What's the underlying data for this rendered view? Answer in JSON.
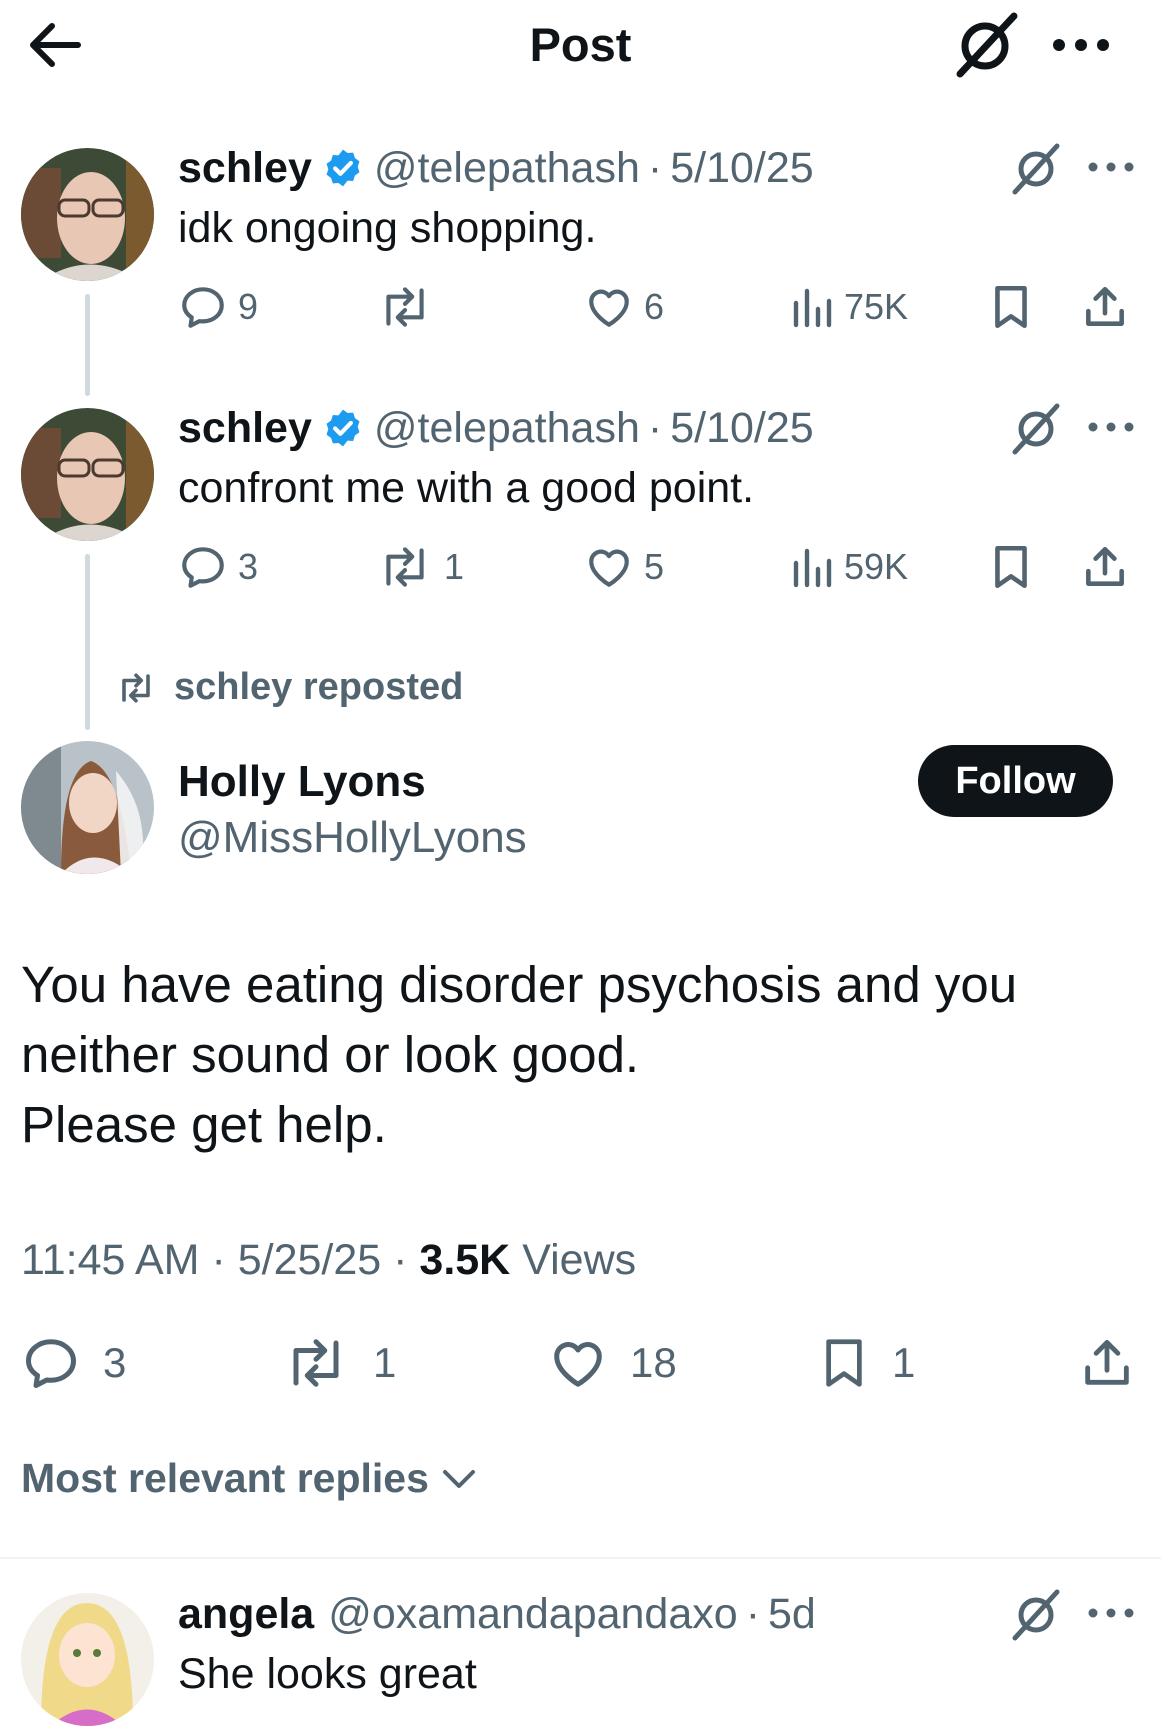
{
  "header": {
    "title": "Post",
    "back_icon": "arrow-left-icon",
    "grok_icon": "grok-icon",
    "more_icon": "more-horizontal-icon"
  },
  "thread": [
    {
      "name": "schley",
      "handle": "@telepathash",
      "date": "5/10/25",
      "text": "idk ongoing shopping.",
      "replies": "9",
      "reposts": "",
      "likes": "6",
      "views": "75K"
    },
    {
      "name": "schley",
      "handle": "@telepathash",
      "date": "5/10/25",
      "text": "confront me with a good point.",
      "replies": "3",
      "reposts": "1",
      "likes": "5",
      "views": "59K"
    }
  ],
  "repost_banner": "schley reposted",
  "main_post": {
    "name": "Holly Lyons",
    "handle": "@MissHollyLyons",
    "follow_label": "Follow",
    "text": "You have eating disorder psychosis and you\nneither sound or look good.\nPlease get help.",
    "time": "11:45 AM",
    "date": "5/25/25",
    "views_count": "3.5K",
    "views_label": "Views",
    "replies": "3",
    "reposts": "1",
    "likes": "18",
    "bookmarks": "1"
  },
  "replies_sort": "Most relevant replies",
  "reply": {
    "name": "angela",
    "handle": "@oxamandapandaxo",
    "date": "5d",
    "text": "She looks great"
  },
  "colors": {
    "text": "#0f1419",
    "secondary": "#536471",
    "verified": "#1d9bf0",
    "divider": "#eff3f4"
  }
}
